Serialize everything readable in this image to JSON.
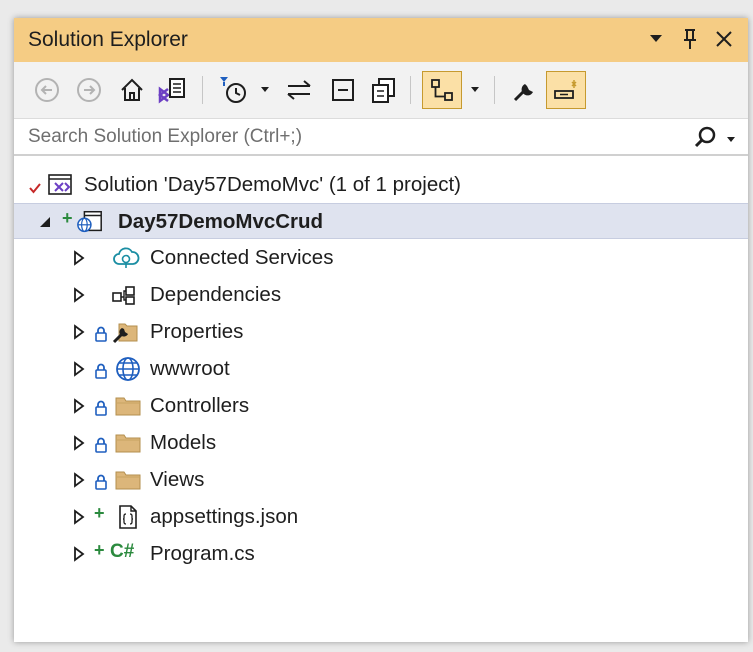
{
  "window": {
    "title": "Solution Explorer"
  },
  "search": {
    "placeholder": "Search Solution Explorer (Ctrl+;)"
  },
  "tree": {
    "solution": "Solution 'Day57DemoMvc' (1 of 1 project)",
    "project": "Day57DemoMvcCrud",
    "items": [
      {
        "label": "Connected Services",
        "icon": "connected-services-icon"
      },
      {
        "label": "Dependencies",
        "icon": "dependencies-icon"
      },
      {
        "label": "Properties",
        "icon": "properties-icon"
      },
      {
        "label": "wwwroot",
        "icon": "globe-icon"
      },
      {
        "label": "Controllers",
        "icon": "folder-icon"
      },
      {
        "label": "Models",
        "icon": "folder-icon"
      },
      {
        "label": "Views",
        "icon": "folder-icon"
      },
      {
        "label": "appsettings.json",
        "icon": "json-file-icon"
      },
      {
        "label": "Program.cs",
        "icon": "csharp-file-icon"
      }
    ]
  },
  "glyphs": {
    "csharp": "C#"
  },
  "colors": {
    "title_bar": "#f5cc84",
    "toolbar": "#f2f2f2",
    "selection": "#dfe3ef",
    "folder": "#dcb67a",
    "lock": "#1f5fbf",
    "added": "#2b8a3e",
    "accent_purple": "#6c3fc4"
  }
}
